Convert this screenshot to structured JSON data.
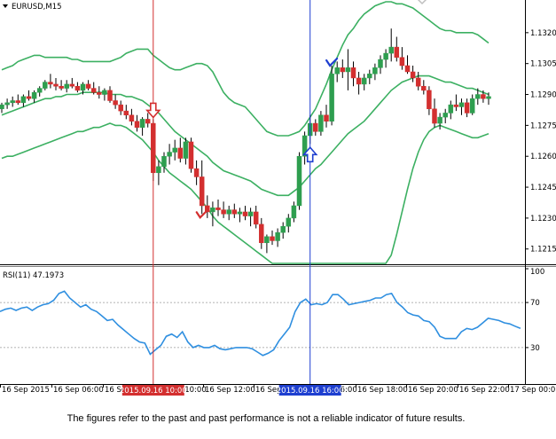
{
  "symbol_label": "EURUSD,M15",
  "indicator_label": "RSI(11) 47.1973",
  "disclaimer": "The figures refer to the past and past performance is not a reliable indicator of future results.",
  "colors": {
    "bull": "#2e9e4f",
    "bear": "#d32f2f",
    "bands": "#3cb062",
    "rsi": "#2f8fe0",
    "sell_marker": "#d32f2f",
    "buy_marker": "#1e3fd0",
    "sell_time_bg": "#d32f2f",
    "buy_time_bg": "#1e3fd0"
  },
  "chart_data": [
    {
      "type": "candlestick",
      "ylim": [
        1.1208,
        1.1335
      ],
      "price_ticks": [
        "1.1320",
        "1.1305",
        "1.1290",
        "1.1275",
        "1.1260",
        "1.1245",
        "1.1230",
        "1.1215"
      ],
      "time_ticks": [
        "16 Sep 2015",
        "16 Sep 06:00",
        "16 Sep 08:00",
        "16 Sep 10:00",
        "16 Sep 12:00",
        "16 Sep 14:00",
        "16 Sep 16:00",
        "16 Sep 18:00",
        "16 Sep 20:00",
        "16 Sep 22:00",
        "17 Sep 00:00"
      ],
      "highlighted_times": [
        {
          "label": "2015.09.16 10:00",
          "index": 28,
          "kind": "sell"
        },
        {
          "label": "2015.09.16 16:00",
          "index": 57,
          "kind": "buy"
        }
      ],
      "candles": [
        [
          1.1283,
          1.1286,
          1.1281,
          1.1285
        ],
        [
          1.1285,
          1.1288,
          1.1283,
          1.1286
        ],
        [
          1.1286,
          1.1289,
          1.1284,
          1.1287
        ],
        [
          1.1287,
          1.129,
          1.1285,
          1.1286
        ],
        [
          1.1286,
          1.129,
          1.1284,
          1.1289
        ],
        [
          1.1289,
          1.1292,
          1.1287,
          1.1288
        ],
        [
          1.1288,
          1.1292,
          1.1286,
          1.1291
        ],
        [
          1.1291,
          1.1294,
          1.1289,
          1.1293
        ],
        [
          1.1293,
          1.1297,
          1.1292,
          1.1296
        ],
        [
          1.1296,
          1.13,
          1.1293,
          1.1295
        ],
        [
          1.1295,
          1.1298,
          1.1292,
          1.1294
        ],
        [
          1.1294,
          1.1297,
          1.1292,
          1.1293
        ],
        [
          1.1293,
          1.1297,
          1.1291,
          1.1295
        ],
        [
          1.1295,
          1.1298,
          1.1293,
          1.1294
        ],
        [
          1.1294,
          1.1296,
          1.1291,
          1.1292
        ],
        [
          1.1292,
          1.1296,
          1.129,
          1.1295
        ],
        [
          1.1295,
          1.1297,
          1.1292,
          1.1293
        ],
        [
          1.1293,
          1.1296,
          1.129,
          1.1291
        ],
        [
          1.1291,
          1.1294,
          1.1288,
          1.129
        ],
        [
          1.129,
          1.1293,
          1.1287,
          1.1292
        ],
        [
          1.1292,
          1.1294,
          1.1286,
          1.1287
        ],
        [
          1.1287,
          1.129,
          1.1283,
          1.1285
        ],
        [
          1.1285,
          1.1287,
          1.128,
          1.1282
        ],
        [
          1.1282,
          1.1285,
          1.1278,
          1.128
        ],
        [
          1.128,
          1.1283,
          1.1275,
          1.1277
        ],
        [
          1.1277,
          1.128,
          1.1272,
          1.1274
        ],
        [
          1.1274,
          1.1279,
          1.127,
          1.1278
        ],
        [
          1.1278,
          1.1281,
          1.1274,
          1.1276
        ],
        [
          1.1276,
          1.1278,
          1.1248,
          1.1252
        ],
        [
          1.1252,
          1.1258,
          1.1246,
          1.1255
        ],
        [
          1.1255,
          1.1262,
          1.1252,
          1.126
        ],
        [
          1.126,
          1.1266,
          1.1256,
          1.1262
        ],
        [
          1.1262,
          1.1268,
          1.1258,
          1.1264
        ],
        [
          1.1264,
          1.1269,
          1.1257,
          1.1259
        ],
        [
          1.1259,
          1.1269,
          1.1256,
          1.1267
        ],
        [
          1.1267,
          1.1269,
          1.1252,
          1.1254
        ],
        [
          1.1254,
          1.1258,
          1.1246,
          1.125
        ],
        [
          1.125,
          1.1258,
          1.1232,
          1.1236
        ],
        [
          1.1236,
          1.1241,
          1.123,
          1.1233
        ],
        [
          1.1233,
          1.1238,
          1.1226,
          1.1235
        ],
        [
          1.1235,
          1.1239,
          1.1231,
          1.1234
        ],
        [
          1.1234,
          1.1238,
          1.123,
          1.1232
        ],
        [
          1.1232,
          1.1236,
          1.1229,
          1.1234
        ],
        [
          1.1234,
          1.1237,
          1.123,
          1.1232
        ],
        [
          1.1232,
          1.1235,
          1.1228,
          1.1233
        ],
        [
          1.1233,
          1.1236,
          1.1229,
          1.1231
        ],
        [
          1.1231,
          1.1235,
          1.1226,
          1.1233
        ],
        [
          1.1233,
          1.1236,
          1.1225,
          1.1227
        ],
        [
          1.1227,
          1.123,
          1.1215,
          1.1218
        ],
        [
          1.1218,
          1.1222,
          1.1213,
          1.1221
        ],
        [
          1.1221,
          1.1224,
          1.1217,
          1.1219
        ],
        [
          1.1219,
          1.1225,
          1.1216,
          1.1223
        ],
        [
          1.1223,
          1.1228,
          1.122,
          1.1226
        ],
        [
          1.1226,
          1.1232,
          1.1223,
          1.123
        ],
        [
          1.123,
          1.1238,
          1.1228,
          1.1236
        ],
        [
          1.1236,
          1.1262,
          1.1234,
          1.126
        ],
        [
          1.126,
          1.1272,
          1.1256,
          1.127
        ],
        [
          1.127,
          1.128,
          1.1266,
          1.1276
        ],
        [
          1.1276,
          1.1278,
          1.127,
          1.1272
        ],
        [
          1.1272,
          1.1282,
          1.127,
          1.128
        ],
        [
          1.128,
          1.1285,
          1.1274,
          1.1277
        ],
        [
          1.1277,
          1.1304,
          1.1275,
          1.13
        ],
        [
          1.13,
          1.1306,
          1.1296,
          1.1303
        ],
        [
          1.1303,
          1.1307,
          1.1298,
          1.1301
        ],
        [
          1.1301,
          1.1312,
          1.1292,
          1.1303
        ],
        [
          1.1303,
          1.1306,
          1.1294,
          1.1298
        ],
        [
          1.1298,
          1.1301,
          1.129,
          1.1295
        ],
        [
          1.1295,
          1.13,
          1.1292,
          1.1298
        ],
        [
          1.1298,
          1.1302,
          1.1295,
          1.13
        ],
        [
          1.13,
          1.1305,
          1.1297,
          1.1303
        ],
        [
          1.1303,
          1.1309,
          1.13,
          1.1307
        ],
        [
          1.1307,
          1.1312,
          1.1303,
          1.131
        ],
        [
          1.131,
          1.1322,
          1.1306,
          1.1313
        ],
        [
          1.1313,
          1.1318,
          1.1306,
          1.1308
        ],
        [
          1.1308,
          1.1313,
          1.1302,
          1.1304
        ],
        [
          1.1304,
          1.1309,
          1.13,
          1.1301
        ],
        [
          1.1301,
          1.1304,
          1.1296,
          1.1298
        ],
        [
          1.1298,
          1.1301,
          1.1292,
          1.1294
        ],
        [
          1.1294,
          1.1297,
          1.129,
          1.1292
        ],
        [
          1.1292,
          1.1294,
          1.128,
          1.1283
        ],
        [
          1.1283,
          1.1288,
          1.1274,
          1.1276
        ],
        [
          1.1276,
          1.1281,
          1.1273,
          1.1279
        ],
        [
          1.1279,
          1.1283,
          1.1276,
          1.1281
        ],
        [
          1.1281,
          1.1287,
          1.1278,
          1.1285
        ],
        [
          1.1285,
          1.129,
          1.1282,
          1.1284
        ],
        [
          1.1284,
          1.1288,
          1.128,
          1.1286
        ],
        [
          1.1286,
          1.1288,
          1.1279,
          1.1281
        ],
        [
          1.1281,
          1.129,
          1.128,
          1.1288
        ],
        [
          1.1288,
          1.1293,
          1.1285,
          1.129
        ],
        [
          1.129,
          1.1292,
          1.1286,
          1.1288
        ],
        [
          1.1288,
          1.1291,
          1.1285,
          1.1289
        ]
      ],
      "bollinger_upper": [
        1.1302,
        1.1303,
        1.1304,
        1.1306,
        1.1307,
        1.1308,
        1.1309,
        1.1309,
        1.1308,
        1.1308,
        1.1308,
        1.1308,
        1.1308,
        1.1307,
        1.1307,
        1.1306,
        1.1306,
        1.1306,
        1.1306,
        1.1306,
        1.1306,
        1.1307,
        1.1308,
        1.131,
        1.1311,
        1.1312,
        1.1312,
        1.1312,
        1.1309,
        1.1307,
        1.1305,
        1.1303,
        1.1302,
        1.1302,
        1.1303,
        1.1304,
        1.1305,
        1.1305,
        1.1304,
        1.1301,
        1.1296,
        1.1291,
        1.1288,
        1.1286,
        1.1285,
        1.1284,
        1.1281,
        1.1278,
        1.1275,
        1.1272,
        1.1271,
        1.127,
        1.127,
        1.127,
        1.1271,
        1.1272,
        1.1275,
        1.1279,
        1.1283,
        1.1289,
        1.1295,
        1.1302,
        1.1308,
        1.1314,
        1.1319,
        1.1322,
        1.1326,
        1.1329,
        1.1331,
        1.1333,
        1.1334,
        1.1335,
        1.1335,
        1.1334,
        1.1334,
        1.1333,
        1.1332,
        1.133,
        1.1328,
        1.1326,
        1.1324,
        1.1322,
        1.1321,
        1.1321,
        1.132,
        1.132,
        1.132,
        1.132,
        1.1319,
        1.1317,
        1.1315
      ],
      "bollinger_middle": [
        1.128,
        1.1281,
        1.1282,
        1.1283,
        1.1284,
        1.1285,
        1.1286,
        1.1287,
        1.1288,
        1.1288,
        1.1289,
        1.1289,
        1.129,
        1.129,
        1.129,
        1.1291,
        1.1291,
        1.1291,
        1.1291,
        1.1291,
        1.129,
        1.129,
        1.129,
        1.1289,
        1.1289,
        1.1288,
        1.1287,
        1.1285,
        1.1283,
        1.1281,
        1.1278,
        1.1275,
        1.1272,
        1.127,
        1.1268,
        1.1266,
        1.1264,
        1.1262,
        1.126,
        1.1257,
        1.1255,
        1.1253,
        1.1252,
        1.1251,
        1.125,
        1.1249,
        1.1248,
        1.1246,
        1.1244,
        1.1243,
        1.1242,
        1.1241,
        1.1241,
        1.1241,
        1.1243,
        1.1245,
        1.1248,
        1.1251,
        1.1254,
        1.1256,
        1.1259,
        1.1262,
        1.1265,
        1.1268,
        1.1271,
        1.1273,
        1.1275,
        1.1277,
        1.128,
        1.1283,
        1.1286,
        1.1289,
        1.1292,
        1.1294,
        1.1296,
        1.1297,
        1.1298,
        1.1299,
        1.1299,
        1.1299,
        1.1298,
        1.1297,
        1.1296,
        1.1296,
        1.1295,
        1.1294,
        1.1293,
        1.1293,
        1.1292,
        1.1291,
        1.129
      ],
      "bollinger_lower": [
        1.1259,
        1.126,
        1.126,
        1.1261,
        1.1262,
        1.1263,
        1.1264,
        1.1265,
        1.1266,
        1.1267,
        1.1268,
        1.1269,
        1.127,
        1.1271,
        1.1272,
        1.1272,
        1.1273,
        1.1274,
        1.1274,
        1.1275,
        1.1276,
        1.1275,
        1.1275,
        1.1274,
        1.1272,
        1.127,
        1.1268,
        1.1265,
        1.1262,
        1.1258,
        1.1255,
        1.1252,
        1.125,
        1.1248,
        1.1246,
        1.1244,
        1.1241,
        1.1238,
        1.1235,
        1.1231,
        1.1228,
        1.1226,
        1.1224,
        1.1222,
        1.122,
        1.1218,
        1.1216,
        1.1214,
        1.1212,
        1.121,
        1.1208,
        1.1208,
        1.1208,
        1.1208,
        1.1208,
        1.1208,
        1.1208,
        1.1208,
        1.1208,
        1.1208,
        1.1208,
        1.1208,
        1.1208,
        1.1208,
        1.1208,
        1.1208,
        1.1208,
        1.1208,
        1.1208,
        1.1208,
        1.1208,
        1.1208,
        1.1212,
        1.1222,
        1.1233,
        1.1244,
        1.1254,
        1.1262,
        1.1268,
        1.1272,
        1.1274,
        1.1275,
        1.1274,
        1.1273,
        1.1272,
        1.1271,
        1.127,
        1.1269,
        1.1269,
        1.127,
        1.1271
      ]
    },
    {
      "type": "line",
      "name": "RSI(11)",
      "value_label": "47.1973",
      "ylim": [
        0,
        100
      ],
      "y_ticks": [
        "100",
        "70",
        "30",
        "0"
      ],
      "levels": [
        70,
        30
      ],
      "values": [
        62,
        64,
        65,
        63,
        65,
        66,
        63,
        66,
        68,
        69,
        72,
        78,
        80,
        74,
        70,
        66,
        68,
        64,
        62,
        58,
        54,
        55,
        50,
        46,
        42,
        38,
        35,
        34,
        24,
        28,
        32,
        40,
        42,
        39,
        44,
        35,
        30,
        32,
        30,
        30,
        32,
        29,
        28,
        29,
        30,
        30,
        30,
        29,
        26,
        23,
        25,
        28,
        36,
        42,
        48,
        62,
        70,
        73,
        68,
        69,
        68,
        70,
        77,
        77,
        73,
        68,
        69,
        70,
        71,
        72,
        74,
        74,
        77,
        78,
        70,
        66,
        61,
        59,
        58,
        54,
        53,
        48,
        40,
        38,
        38,
        38,
        44,
        47,
        46,
        48,
        52,
        56,
        55,
        54,
        52,
        51,
        49,
        47
      ]
    }
  ]
}
